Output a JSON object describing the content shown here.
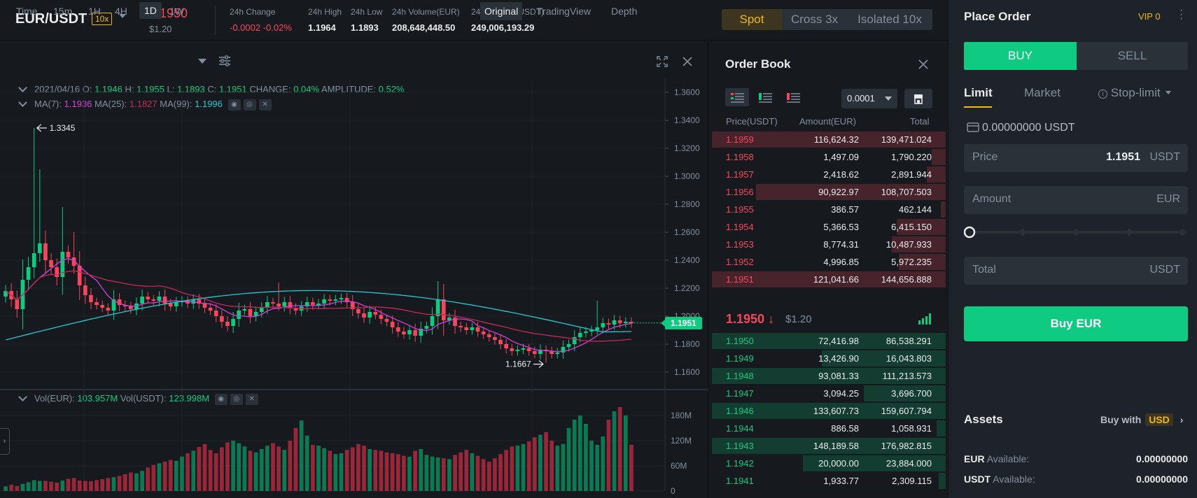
{
  "header": {
    "pair": "EUR/USDT",
    "leverage": "10x",
    "last_price": "1.1950",
    "last_price_fiat": "$1.20",
    "stats": [
      {
        "label": "24h Change",
        "value": "-0.0002 -0.02%",
        "color": "#f6465d"
      },
      {
        "label": "24h High",
        "value": "1.1964",
        "color": "#eaecef"
      },
      {
        "label": "24h Low",
        "value": "1.1893",
        "color": "#eaecef"
      },
      {
        "label": "24h Volume(EUR)",
        "value": "208,648,448.50",
        "color": "#eaecef"
      },
      {
        "label": "24h Volume(USDT)",
        "value": "249,006,193.29",
        "color": "#eaecef"
      }
    ],
    "modes": [
      "Spot",
      "Cross 3x",
      "Isolated 10x"
    ],
    "active_mode": "Spot"
  },
  "chart_toolbar": {
    "timeframes": [
      "Time",
      "15m",
      "1H",
      "4H",
      "1D",
      "1W"
    ],
    "active_timeframe": "1D",
    "views": [
      "Original",
      "TradingView",
      "Depth"
    ],
    "active_view": "Original"
  },
  "chart_info": {
    "date": "2021/04/16",
    "o_label": "O:",
    "o": "1.1946",
    "h_label": "H:",
    "h": "1.1955",
    "l_label": "L:",
    "l": "1.1893",
    "c_label": "C:",
    "c": "1.1951",
    "change_label": "CHANGE:",
    "change": "0.04%",
    "amplitude_label": "AMPLITUDE:",
    "amplitude": "0.52%",
    "ma7_label": "MA(7):",
    "ma7": "1.1936",
    "ma25_label": "MA(25):",
    "ma25": "1.1827",
    "ma99_label": "MA(99):",
    "ma99": "1.1996",
    "vol_eur_label": "Vol(EUR):",
    "vol_eur": "103.957M",
    "vol_usdt_label": "Vol(USDT):",
    "vol_usdt": "123.998M",
    "current_price_tag": "1.1951",
    "max_marker": "1.3345",
    "min_marker": "1.1667"
  },
  "chart_data": {
    "type": "candlestick",
    "price_axis": {
      "ticks": [
        "1.3600",
        "1.3400",
        "1.3200",
        "1.3000",
        "1.2800",
        "1.2600",
        "1.2400",
        "1.2200",
        "1.2000",
        "1.1800",
        "1.1600"
      ],
      "ylim": [
        1.15,
        1.37
      ]
    },
    "volume_axis": {
      "ticks": [
        "180M",
        "120M",
        "60M",
        "0"
      ],
      "ylim": [
        0,
        200
      ]
    },
    "colors": {
      "up": "#0ecb81",
      "down": "#f6465d",
      "ma7": "#d440d8",
      "ma25": "#c4295a",
      "ma99": "#2ac6cf"
    },
    "closes": [
      1.218,
      1.212,
      1.205,
      1.226,
      1.235,
      1.245,
      1.252,
      1.24,
      1.235,
      1.228,
      1.246,
      1.242,
      1.236,
      1.222,
      1.215,
      1.21,
      1.208,
      1.206,
      1.204,
      1.212,
      1.208,
      1.207,
      1.205,
      1.209,
      1.214,
      1.212,
      1.211,
      1.214,
      1.209,
      1.207,
      1.21,
      1.211,
      1.209,
      1.212,
      1.209,
      1.206,
      1.204,
      1.2,
      1.196,
      1.193,
      1.198,
      1.204,
      1.205,
      1.2,
      1.203,
      1.206,
      1.21,
      1.209,
      1.207,
      1.21,
      1.206,
      1.204,
      1.207,
      1.21,
      1.208,
      1.209,
      1.212,
      1.211,
      1.212,
      1.213,
      1.21,
      1.205,
      1.202,
      1.199,
      1.203,
      1.201,
      1.198,
      1.196,
      1.192,
      1.189,
      1.187,
      1.19,
      1.186,
      1.191,
      1.193,
      1.2,
      1.212,
      1.197,
      1.199,
      1.193,
      1.192,
      1.19,
      1.192,
      1.189,
      1.187,
      1.185,
      1.183,
      1.18,
      1.177,
      1.175,
      1.176,
      1.177,
      1.175,
      1.173,
      1.176,
      1.175,
      1.173,
      1.174,
      1.178,
      1.18,
      1.185,
      1.188,
      1.189,
      1.19,
      1.192,
      1.195,
      1.194,
      1.197,
      1.195,
      1.196,
      1.195
    ],
    "volumes": [
      11,
      15,
      12,
      17,
      21,
      26,
      24,
      24,
      22,
      20,
      25,
      29,
      31,
      25,
      24,
      23,
      26,
      28,
      31,
      33,
      36,
      40,
      44,
      42,
      48,
      56,
      62,
      66,
      70,
      74,
      72,
      82,
      90,
      96,
      105,
      112,
      98,
      90,
      104,
      116,
      120,
      114,
      106,
      96,
      92,
      100,
      108,
      114,
      106,
      98,
      120,
      150,
      168,
      132,
      110,
      108,
      102,
      96,
      88,
      90,
      98,
      104,
      112,
      108,
      100,
      98,
      96,
      92,
      90,
      88,
      84,
      82,
      96,
      100,
      86,
      82,
      80,
      78,
      76,
      86,
      92,
      98,
      90,
      84,
      76,
      70,
      78,
      88,
      98,
      106,
      108,
      112,
      118,
      128,
      134,
      140,
      120,
      108,
      112,
      150,
      170,
      180,
      160,
      120,
      110,
      130,
      170,
      190,
      200,
      180,
      110
    ]
  },
  "orderbook": {
    "title": "Order Book",
    "precision": "0.0001",
    "headers": [
      "Price(USDT)",
      "Amount(EUR)",
      "Total"
    ],
    "asks": [
      {
        "price": "1.1959",
        "amount": "116,624.32",
        "total": "139,471.024",
        "depth": 1.0
      },
      {
        "price": "1.1958",
        "amount": "1,497.09",
        "total": "1,790.220",
        "depth": 0.06
      },
      {
        "price": "1.1957",
        "amount": "2,418.62",
        "total": "2,891.944",
        "depth": 0.08
      },
      {
        "price": "1.1956",
        "amount": "90,922.97",
        "total": "108,707.503",
        "depth": 0.81
      },
      {
        "price": "1.1955",
        "amount": "386.57",
        "total": "462.144",
        "depth": 0.02
      },
      {
        "price": "1.1954",
        "amount": "5,366.53",
        "total": "6,415.150",
        "depth": 0.21
      },
      {
        "price": "1.1953",
        "amount": "8,774.31",
        "total": "10,487.933",
        "depth": 0.23
      },
      {
        "price": "1.1952",
        "amount": "4,996.85",
        "total": "5,972.235",
        "depth": 0.2
      },
      {
        "price": "1.1951",
        "amount": "121,041.66",
        "total": "144,656.888",
        "depth": 1.0
      }
    ],
    "mid_price": "1.1950",
    "mid_arrow": "↓",
    "mid_fiat": "$1.20",
    "bids": [
      {
        "price": "1.1950",
        "amount": "72,416.98",
        "total": "86,538.291",
        "depth": 1.0
      },
      {
        "price": "1.1949",
        "amount": "13,426.90",
        "total": "16,043.803",
        "depth": 0.53
      },
      {
        "price": "1.1948",
        "amount": "93,081.33",
        "total": "111,213.573",
        "depth": 1.0
      },
      {
        "price": "1.1947",
        "amount": "3,094.25",
        "total": "3,696.700",
        "depth": 0.35
      },
      {
        "price": "1.1946",
        "amount": "133,607.73",
        "total": "159,607.794",
        "depth": 1.0
      },
      {
        "price": "1.1944",
        "amount": "886.58",
        "total": "1,058.931",
        "depth": 0.04
      },
      {
        "price": "1.1943",
        "amount": "148,189.58",
        "total": "176,982.815",
        "depth": 1.0
      },
      {
        "price": "1.1942",
        "amount": "20,000.00",
        "total": "23,884.000",
        "depth": 0.61
      },
      {
        "price": "1.1941",
        "amount": "1,933.77",
        "total": "2,309.115",
        "depth": 0.03
      }
    ]
  },
  "place_order": {
    "title": "Place Order",
    "vip": "VIP 0",
    "buy_tab": "BUY",
    "sell_tab": "SELL",
    "order_types": [
      "Limit",
      "Market",
      "Stop-limit"
    ],
    "active_type": "Limit",
    "balance": "0.00000000 USDT",
    "price_label": "Price",
    "price_value": "1.1951",
    "price_unit": "USDT",
    "amount_label": "Amount",
    "amount_unit": "EUR",
    "total_label": "Total",
    "total_unit": "USDT",
    "slider_percent": 0,
    "submit": "Buy EUR",
    "assets_title": "Assets",
    "buy_with": "Buy with",
    "buy_with_currency": "USD",
    "assets": [
      {
        "currency": "EUR",
        "label": "Available:",
        "value": "0.00000000"
      },
      {
        "currency": "USDT",
        "label": "Available:",
        "value": "0.00000000"
      }
    ]
  }
}
